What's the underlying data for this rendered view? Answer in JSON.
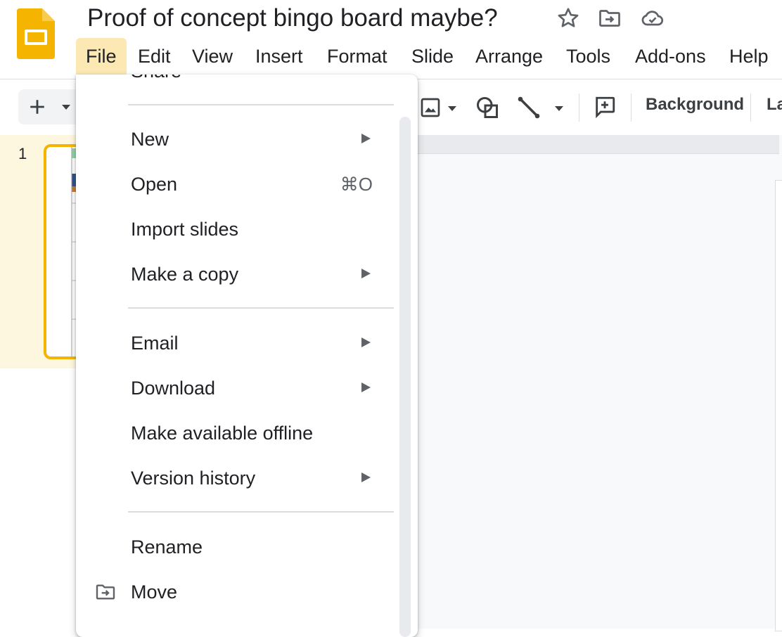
{
  "header": {
    "doc_title": "Proof of concept bingo board maybe?",
    "icons": [
      "slides-logo-icon",
      "star-icon",
      "move-folder-icon",
      "cloud-saved-icon"
    ],
    "menu": [
      "File",
      "Edit",
      "View",
      "Insert",
      "Format",
      "Slide",
      "Arrange",
      "Tools",
      "Add-ons",
      "Help"
    ]
  },
  "toolbar": {
    "icons": [
      "add-icon",
      "dropdown-icon",
      "image-icon",
      "shape-icon",
      "line-icon",
      "comment-icon"
    ],
    "background_label": "Background",
    "layout_label_partial": "La"
  },
  "filmstrip": {
    "slide_number": "1"
  },
  "file_menu": {
    "cut_top_label": "Share",
    "items": [
      {
        "label": "New",
        "submenu": true
      },
      {
        "label": "Open",
        "shortcut": "⌘O"
      },
      {
        "label": "Import slides"
      },
      {
        "label": "Make a copy",
        "submenu": true
      },
      {
        "label": "Email",
        "submenu": true
      },
      {
        "label": "Download",
        "submenu": true
      },
      {
        "label": "Make available offline"
      },
      {
        "label": "Version history",
        "submenu": true
      },
      {
        "label": "Rename"
      },
      {
        "label": "Move",
        "icon": "move-folder-icon"
      }
    ]
  },
  "colors": {
    "slides_yellow": "#f4b400",
    "active_menu_bg": "#fce8b2",
    "selected_slide_bg": "#fef7e0"
  }
}
